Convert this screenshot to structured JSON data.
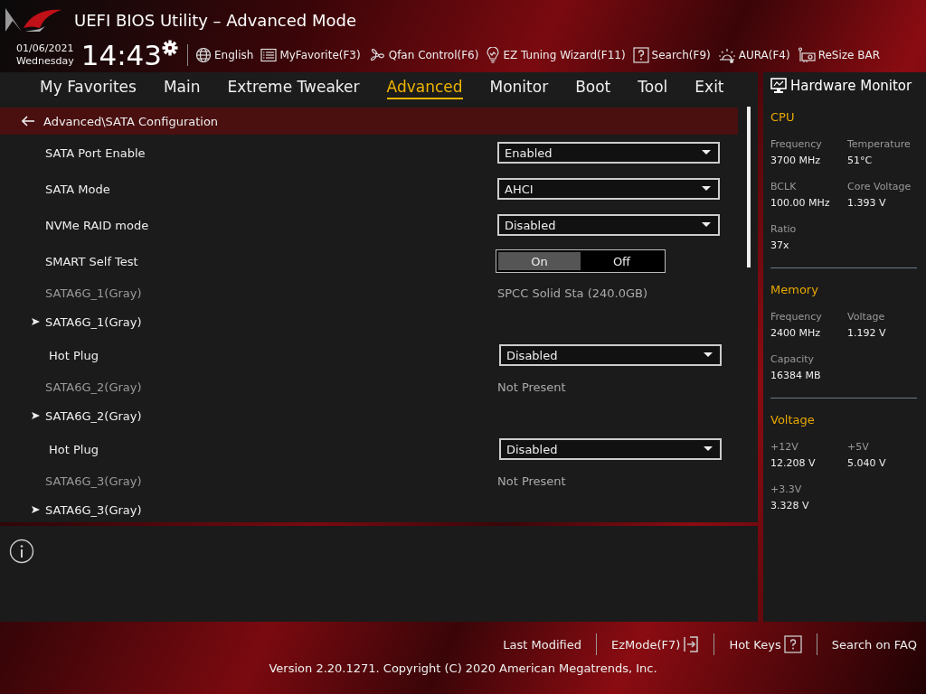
{
  "header": {
    "title": "UEFI BIOS Utility – Advanced Mode",
    "date": "01/06/2021",
    "day": "Wednesday",
    "time": "14:43",
    "tools": [
      {
        "label": "English"
      },
      {
        "label": "MyFavorite(F3)"
      },
      {
        "label": "Qfan Control(F6)"
      },
      {
        "label": "EZ Tuning Wizard(F11)"
      },
      {
        "label": "Search(F9)"
      },
      {
        "label": "AURA(F4)"
      },
      {
        "label": "ReSize BAR"
      }
    ]
  },
  "tabs": [
    {
      "label": "My Favorites",
      "selected": false
    },
    {
      "label": "Main",
      "selected": false
    },
    {
      "label": "Extreme Tweaker",
      "selected": false
    },
    {
      "label": "Advanced",
      "selected": true
    },
    {
      "label": "Monitor",
      "selected": false
    },
    {
      "label": "Boot",
      "selected": false
    },
    {
      "label": "Tool",
      "selected": false
    },
    {
      "label": "Exit",
      "selected": false
    }
  ],
  "breadcrumb": "Advanced\\SATA Configuration",
  "settings": [
    {
      "kind": "dropdown",
      "label": "SATA Port Enable",
      "value": "Enabled"
    },
    {
      "kind": "dropdown",
      "label": "SATA Mode",
      "value": "AHCI"
    },
    {
      "kind": "dropdown",
      "label": "NVMe RAID mode",
      "value": "Disabled"
    },
    {
      "kind": "toggle",
      "label": "SMART Self Test",
      "options": [
        {
          "label": "On",
          "selected": true
        },
        {
          "label": "Off",
          "selected": false
        }
      ]
    },
    {
      "kind": "info",
      "label": "SATA6G_1(Gray)",
      "value": "SPCC Solid Sta (240.0GB)"
    },
    {
      "kind": "submenu",
      "label": "SATA6G_1(Gray)",
      "children": [
        {
          "kind": "dropdown",
          "label": "Hot Plug",
          "value": "Disabled"
        }
      ]
    },
    {
      "kind": "info",
      "label": "SATA6G_2(Gray)",
      "value": "Not Present"
    },
    {
      "kind": "submenu",
      "label": "SATA6G_2(Gray)",
      "children": [
        {
          "kind": "dropdown",
          "label": "Hot Plug",
          "value": "Disabled"
        }
      ]
    },
    {
      "kind": "info",
      "label": "SATA6G_3(Gray)",
      "value": "Not Present"
    },
    {
      "kind": "submenu",
      "label": "SATA6G_3(Gray)"
    }
  ],
  "hardware_monitor": {
    "title": "Hardware Monitor",
    "sections": [
      {
        "title": "CPU",
        "items": [
          {
            "label": "Frequency",
            "value": "3700 MHz"
          },
          {
            "label": "Temperature",
            "value": "51°C"
          },
          {
            "label": "BCLK",
            "value": "100.00 MHz"
          },
          {
            "label": "Core Voltage",
            "value": "1.393 V"
          },
          {
            "label": "Ratio",
            "value": "37x"
          }
        ]
      },
      {
        "title": "Memory",
        "items": [
          {
            "label": "Frequency",
            "value": "2400 MHz"
          },
          {
            "label": "Voltage",
            "value": "1.192 V"
          },
          {
            "label": "Capacity",
            "value": "16384 MB"
          }
        ]
      },
      {
        "title": "Voltage",
        "items": [
          {
            "label": "+12V",
            "value": "12.208 V"
          },
          {
            "label": "+5V",
            "value": "5.040 V"
          },
          {
            "label": "+3.3V",
            "value": "3.328 V"
          }
        ]
      }
    ]
  },
  "footer": {
    "links": [
      {
        "label": "Last Modified"
      },
      {
        "label": "EzMode(F7)"
      },
      {
        "label": "Hot Keys"
      },
      {
        "label": "Search on FAQ"
      }
    ],
    "version": "Version 2.20.1271. Copyright (C) 2020 American Megatrends, Inc."
  }
}
